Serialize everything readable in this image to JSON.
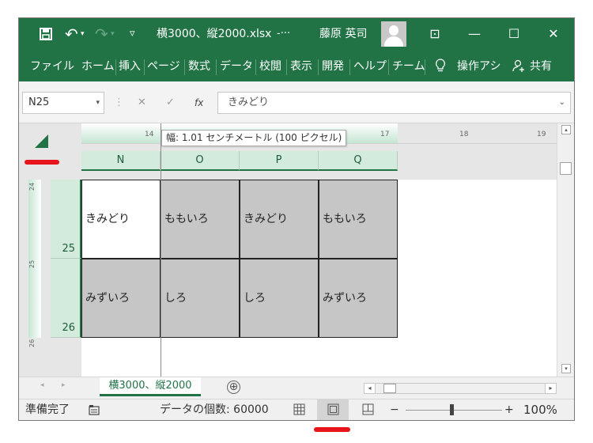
{
  "titlebar": {
    "save_icon": "floppy-disk-icon",
    "undo_icon": "↶",
    "undo_dropdown": "▾",
    "redo_icon": "↷",
    "redo_dropdown": "▾",
    "customize_icon": "▿",
    "file_name": "横3000、縦2000.xlsx",
    "app_suffix": "-···",
    "user_name": "藤原 英司",
    "ribbon_display_icon": "⊡",
    "minimize_icon": "—",
    "maximize_icon": "☐",
    "close_icon": "✕"
  },
  "ribbon": {
    "tabs": [
      "ファイル",
      "ホーム",
      "挿入",
      "ページ",
      "数式",
      "データ",
      "校閲",
      "表示",
      "開発",
      "ヘルプ",
      "チーム"
    ],
    "tell_me_icon": "lightbulb-icon",
    "tell_me": "操作アシ",
    "share_icon": "person-add-icon",
    "share": "共有"
  },
  "formula_bar": {
    "name_box": "N25",
    "name_box_dropdown": "▾",
    "more_icon": "⋮",
    "cancel_icon": "✕",
    "enter_icon": "✓",
    "fx_label": "fx",
    "content": "きみどり",
    "expand_icon": "⌄"
  },
  "ruler": {
    "numbers": [
      "14",
      "17",
      "18",
      "19"
    ],
    "tooltip": "幅: 1.01 センチメートル (100 ピクセル)",
    "left_numbers": [
      "24",
      "25",
      "26"
    ]
  },
  "columns": [
    "N",
    "O",
    "P",
    "Q"
  ],
  "rows": [
    {
      "number": "25",
      "cells": [
        "きみどり",
        "ももいろ",
        "きみどり",
        "ももいろ"
      ]
    },
    {
      "number": "26",
      "cells": [
        "みずいろ",
        "しろ",
        "しろ",
        "みずいろ"
      ]
    }
  ],
  "colors": {
    "excel_green": "#217346",
    "header_selected": "#d2ebdc",
    "cell_gray": "#c6c6c6",
    "annotation_red": "#e8141c"
  },
  "sheet_tabs": {
    "nav_prev": "◂",
    "nav_next": "▸",
    "active": "横3000、縦2000",
    "add_icon": "⊕"
  },
  "status_bar": {
    "ready": "準備完了",
    "macro_icon": "macro-record-icon",
    "count": "データの個数: 60000",
    "view_normal_icon": "grid-icon",
    "view_page_layout_icon": "page-layout-icon",
    "view_page_break_icon": "page-break-icon",
    "zoom_minus": "−",
    "zoom_plus": "+",
    "zoom_level": "100%"
  },
  "scrollbar": {
    "up_icon": "▴",
    "down_icon": "▾",
    "left_icon": "◂",
    "right_icon": "▸"
  }
}
